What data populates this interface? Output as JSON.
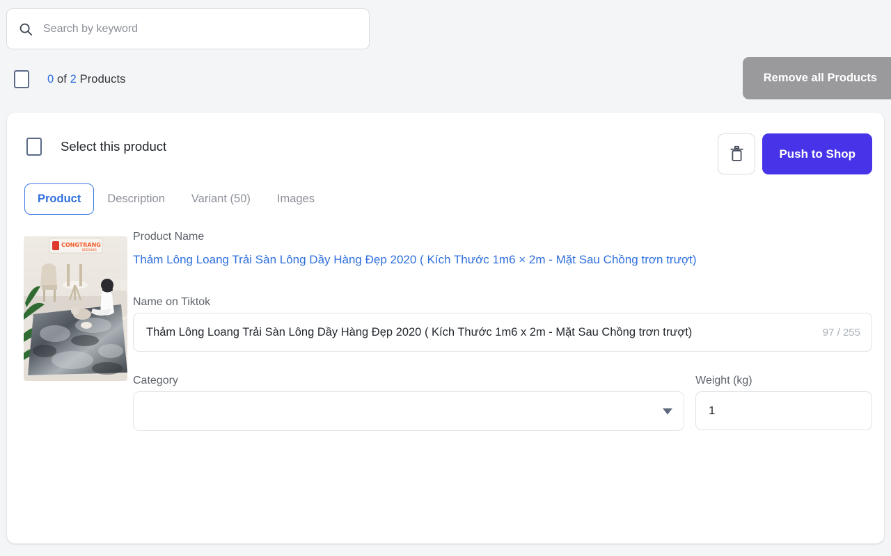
{
  "search": {
    "placeholder": "Search by keyword",
    "value": "",
    "icon": "search-icon"
  },
  "toolbar": {
    "selected_count": "0",
    "of_text": "of",
    "total_count": "2",
    "products_text": "Products",
    "remove_all_label": "Remove all Products",
    "remove_all_color": "#9a9a9d"
  },
  "card": {
    "select_product_label": "Select this product",
    "delete_icon": "trash-icon",
    "push_label": "Push to Shop",
    "push_color": "#4733e8",
    "tabs": [
      {
        "label": "Product",
        "active": true
      },
      {
        "label": "Description",
        "active": false
      },
      {
        "label": "Variant (50)",
        "active": false
      },
      {
        "label": "Images",
        "active": false
      }
    ],
    "thumbnail_alt": "gray shag rug in living room with person sitting, CONGTRANG banner",
    "fields": {
      "product_name_label": "Product Name",
      "product_name_value": "Thảm Lông Loang Trải Sàn Lông Dầy Hàng Đẹp 2020 ( Kích Thước 1m6 × 2m - Mặt Sau Chồng trơn trượt)",
      "product_name_color": "#2f6fdd",
      "tiktok_name_label": "Name on Tiktok",
      "tiktok_name_value": "Thảm Lông Loang Trải Sàn Lông Dầy Hàng Đẹp 2020 ( Kích Thước 1m6 x 2m - Mặt Sau Chồng trơn trượt)",
      "tiktok_counter": "97 / 255",
      "category_label": "Category",
      "category_value": "",
      "category_caret_icon": "chevron-down-icon",
      "weight_label": "Weight (kg)",
      "weight_value": "1"
    }
  }
}
